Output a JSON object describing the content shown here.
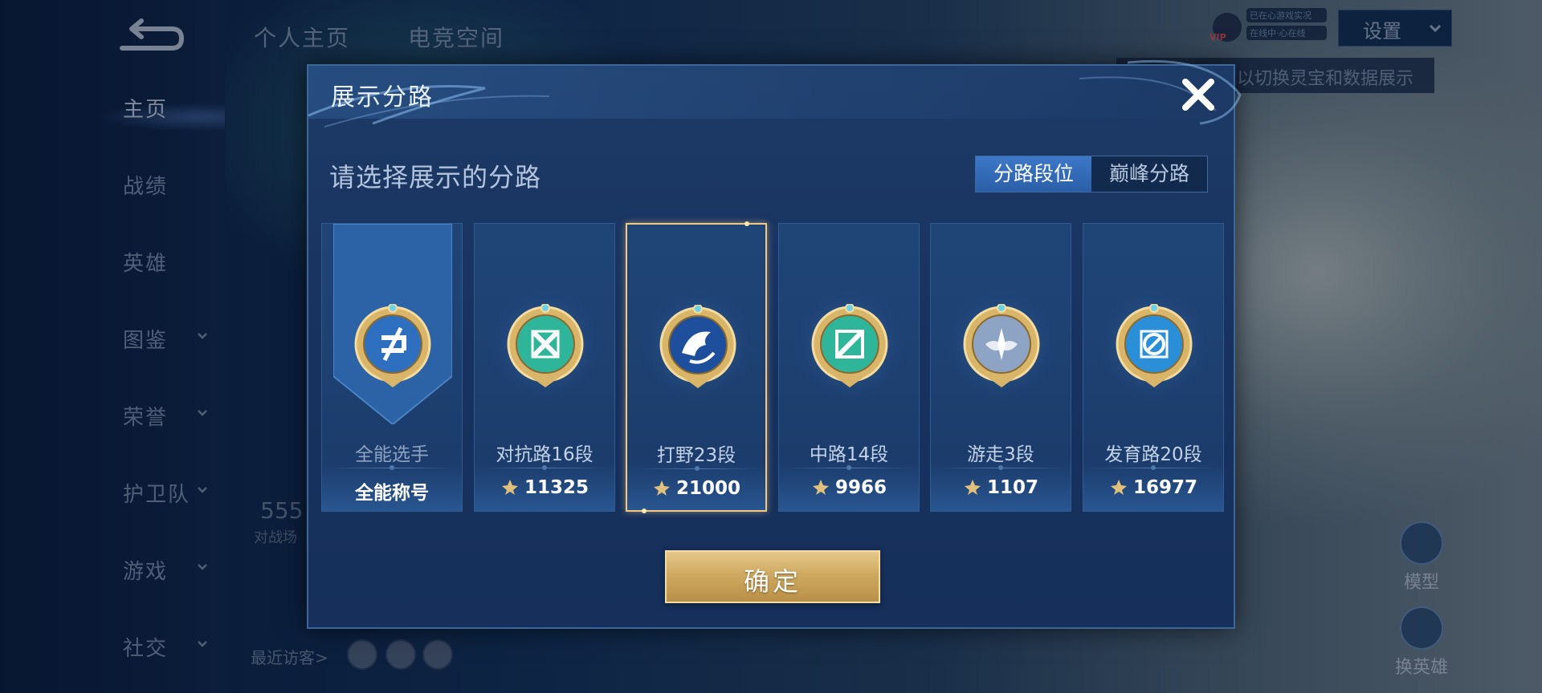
{
  "sidebar": {
    "items": [
      {
        "label": "主页",
        "active": true,
        "has_chevron": false
      },
      {
        "label": "战绩",
        "active": false,
        "has_chevron": false
      },
      {
        "label": "英雄",
        "active": false,
        "has_chevron": false
      },
      {
        "label": "图鉴",
        "active": false,
        "has_chevron": true
      },
      {
        "label": "荣誉",
        "active": false,
        "has_chevron": true
      },
      {
        "label": "护卫队",
        "active": false,
        "has_chevron": true
      },
      {
        "label": "游戏",
        "active": false,
        "has_chevron": true
      },
      {
        "label": "社交",
        "active": false,
        "has_chevron": true
      }
    ]
  },
  "header": {
    "tabs": [
      {
        "label": "个人主页"
      },
      {
        "label": "电竞空间"
      }
    ],
    "settings_label": "设置",
    "vip_label": "VIP",
    "online_status": [
      "已在心游戏实况",
      "在线中·心在线"
    ],
    "tip": "以切换灵宝和数据展示"
  },
  "background": {
    "stat_value": "555",
    "stat_label": "对战场",
    "recent_visitors": "最近访客>",
    "right_buttons": [
      {
        "label": "模型"
      },
      {
        "label": "换英雄"
      }
    ]
  },
  "dialog": {
    "title": "展示分路",
    "prompt": "请选择展示的分路",
    "segment": [
      {
        "label": "分路段位",
        "active": true
      },
      {
        "label": "巅峰分路",
        "active": false
      }
    ],
    "cards": [
      {
        "name": "全能选手",
        "value": "全能称号",
        "icon": "all-round-emblem-icon",
        "selected": false,
        "banner": true,
        "show_points_icon": false,
        "emblem_color": "#2e6fc0"
      },
      {
        "name": "对抗路16段",
        "value": "11325",
        "icon": "clash-lane-emblem-icon",
        "selected": false,
        "banner": false,
        "show_points_icon": true,
        "emblem_color": "#2fb59a"
      },
      {
        "name": "打野23段",
        "value": "21000",
        "icon": "jungle-emblem-icon",
        "selected": true,
        "banner": false,
        "show_points_icon": true,
        "emblem_color": "#1e4f9c"
      },
      {
        "name": "中路14段",
        "value": "9966",
        "icon": "mid-lane-emblem-icon",
        "selected": false,
        "banner": false,
        "show_points_icon": true,
        "emblem_color": "#2fb59a"
      },
      {
        "name": "游走3段",
        "value": "1107",
        "icon": "roam-emblem-icon",
        "selected": false,
        "banner": false,
        "show_points_icon": true,
        "emblem_color": "#8ea4c4"
      },
      {
        "name": "发育路20段",
        "value": "16977",
        "icon": "farm-lane-emblem-icon",
        "selected": false,
        "banner": false,
        "show_points_icon": true,
        "emblem_color": "#2a8fd6"
      }
    ],
    "confirm_label": "确定"
  },
  "colors": {
    "dialog_bg": "#183260",
    "gold": "#f2c982",
    "accent_blue": "#2b5ea8"
  }
}
